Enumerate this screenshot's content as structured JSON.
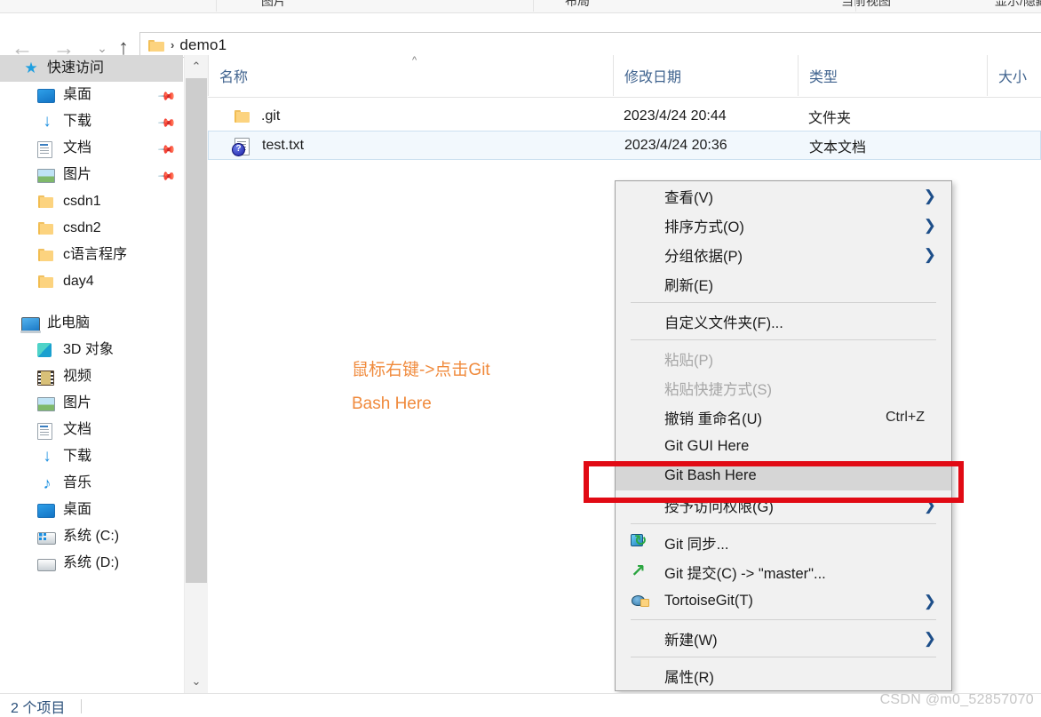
{
  "ribbon": {
    "groups": [
      "图片",
      "布局",
      "当前视图",
      "显示/隐藏"
    ]
  },
  "navbar": {
    "back_icon": "arrow-left",
    "forward_icon": "arrow-right",
    "recent_icon": "chevron-down",
    "up_icon": "arrow-up",
    "breadcrumb_separator": "›",
    "breadcrumb_text": "demo1"
  },
  "tree": {
    "quick_access": {
      "label": "快速访问",
      "icon": "star-icon"
    },
    "quick_items": [
      {
        "label": "桌面",
        "icon": "desktop-icon",
        "pinned": true
      },
      {
        "label": "下载",
        "icon": "download-icon",
        "pinned": true
      },
      {
        "label": "文档",
        "icon": "documents-icon",
        "pinned": true
      },
      {
        "label": "图片",
        "icon": "pictures-icon",
        "pinned": true
      },
      {
        "label": "csdn1",
        "icon": "folder-icon",
        "pinned": false
      },
      {
        "label": "csdn2",
        "icon": "folder-icon",
        "pinned": false
      },
      {
        "label": "c语言程序",
        "icon": "folder-icon",
        "pinned": false
      },
      {
        "label": "day4",
        "icon": "folder-icon",
        "pinned": false
      }
    ],
    "this_pc": {
      "label": "此电脑",
      "icon": "computer-icon"
    },
    "pc_items": [
      {
        "label": "3D 对象",
        "icon": "3d-objects-icon"
      },
      {
        "label": "视频",
        "icon": "videos-icon"
      },
      {
        "label": "图片",
        "icon": "pictures-icon"
      },
      {
        "label": "文档",
        "icon": "documents-icon"
      },
      {
        "label": "下载",
        "icon": "download-icon"
      },
      {
        "label": "音乐",
        "icon": "music-icon"
      },
      {
        "label": "桌面",
        "icon": "desktop-icon"
      },
      {
        "label": "系统 (C:)",
        "icon": "system-drive-icon"
      },
      {
        "label": "系统 (D:)",
        "icon": "drive-icon"
      }
    ],
    "scroll_up_icon": "chevron-up",
    "scroll_down_icon": "chevron-down"
  },
  "filelist": {
    "columns": [
      "名称",
      "修改日期",
      "类型",
      "大小"
    ],
    "sort_indicator": "^",
    "rows": [
      {
        "name": ".git",
        "date": "2023/4/24 20:44",
        "type": "文件夹",
        "size": "",
        "icon": "folder-icon",
        "selected": false
      },
      {
        "name": "test.txt",
        "date": "2023/4/24 20:36",
        "type": "文本文档",
        "size": "",
        "icon": "text-file-icon",
        "selected": true
      }
    ]
  },
  "annotation": {
    "line1": "鼠标右键->点击Git",
    "line2": "Bash Here",
    "color": "#f08a3c"
  },
  "context_menu": {
    "items": [
      {
        "label": "查看(V)",
        "submenu": true,
        "disabled": false,
        "icon": null,
        "accel": "",
        "highlight": false
      },
      {
        "label": "排序方式(O)",
        "submenu": true,
        "disabled": false,
        "icon": null,
        "accel": "",
        "highlight": false
      },
      {
        "label": "分组依据(P)",
        "submenu": true,
        "disabled": false,
        "icon": null,
        "accel": "",
        "highlight": false
      },
      {
        "label": "刷新(E)",
        "submenu": false,
        "disabled": false,
        "icon": null,
        "accel": "",
        "highlight": false
      },
      {
        "separator": true
      },
      {
        "label": "自定义文件夹(F)...",
        "submenu": false,
        "disabled": false,
        "icon": null,
        "accel": "",
        "highlight": false
      },
      {
        "separator": true
      },
      {
        "label": "粘贴(P)",
        "submenu": false,
        "disabled": true,
        "icon": null,
        "accel": "",
        "highlight": false
      },
      {
        "label": "粘贴快捷方式(S)",
        "submenu": false,
        "disabled": true,
        "icon": null,
        "accel": "",
        "highlight": false
      },
      {
        "label": "撤销 重命名(U)",
        "submenu": false,
        "disabled": false,
        "icon": null,
        "accel": "Ctrl+Z",
        "highlight": false
      },
      {
        "label": "Git GUI Here",
        "submenu": false,
        "disabled": false,
        "icon": null,
        "accel": "",
        "highlight": false
      },
      {
        "label": "Git Bash Here",
        "submenu": false,
        "disabled": false,
        "icon": null,
        "accel": "",
        "highlight": true
      },
      {
        "label": "授予访问权限(G)",
        "submenu": true,
        "disabled": false,
        "icon": null,
        "accel": "",
        "highlight": false
      },
      {
        "separator": true
      },
      {
        "label": "Git 同步...",
        "submenu": false,
        "disabled": false,
        "icon": "git-sync-icon",
        "accel": "",
        "highlight": false
      },
      {
        "label": "Git 提交(C) -> \"master\"...",
        "submenu": false,
        "disabled": false,
        "icon": "git-commit-icon",
        "accel": "",
        "highlight": false
      },
      {
        "label": "TortoiseGit(T)",
        "submenu": true,
        "disabled": false,
        "icon": "tortoisegit-icon",
        "accel": "",
        "highlight": false
      },
      {
        "separator": true
      },
      {
        "label": "新建(W)",
        "submenu": true,
        "disabled": false,
        "icon": null,
        "accel": "",
        "highlight": false
      },
      {
        "separator": true
      },
      {
        "label": "属性(R)",
        "submenu": false,
        "disabled": false,
        "icon": null,
        "accel": "",
        "highlight": false
      }
    ],
    "submenu_arrow": "❯",
    "highlight_box_color": "#e10a14"
  },
  "statusbar": {
    "item_count": "2 个项目"
  },
  "watermark": {
    "text": "CSDN @m0_52857070"
  }
}
